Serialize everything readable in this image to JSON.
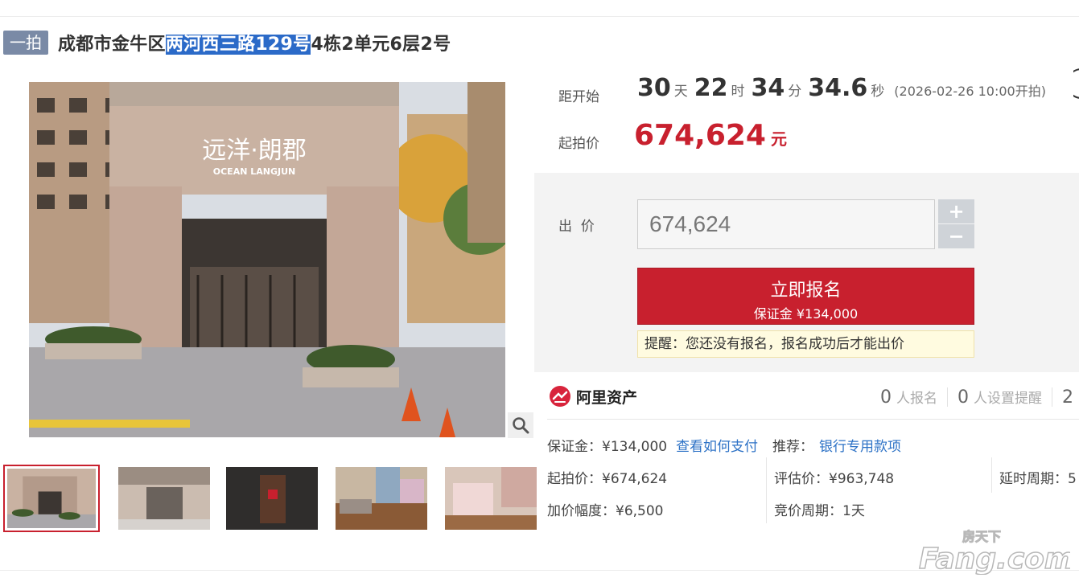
{
  "header": {
    "badge": "一拍",
    "title_prefix": "成都市金牛区",
    "title_highlight": "两河西三路129号",
    "title_suffix": "4栋2单元6层2号"
  },
  "gallery": {
    "main_image_sign_cn": "远洋·朗郡",
    "main_image_sign_en": "OCEAN LANGJUN",
    "thumbnails": [
      "building-entrance",
      "lobby",
      "apartment-door",
      "living-room",
      "bedroom"
    ]
  },
  "countdown": {
    "label": "距开始",
    "days": "30",
    "days_unit": "天",
    "hours": "22",
    "hours_unit": "时",
    "minutes": "34",
    "minutes_unit": "分",
    "seconds": "34.6",
    "seconds_unit": "秒",
    "start_time": "(2026-02-26 10:00开拍)"
  },
  "starting_price": {
    "label": "起拍价",
    "value": "674,624",
    "unit": "元"
  },
  "bid": {
    "label": "出  价",
    "input_value": "674,624",
    "plus": "+",
    "minus": "−",
    "apply_button": "立即报名",
    "deposit_line": "保证金 ¥134,000",
    "notice": "提醒：您还没有报名，报名成功后才能出价"
  },
  "platform": {
    "name": "阿里资产",
    "registrations_count": "0",
    "registrations_label": "人报名",
    "reminders_count": "0",
    "reminders_label": "人设置提醒",
    "views_count_partial": "2"
  },
  "details": {
    "deposit": "保证金：¥134,000",
    "how_to_pay": "查看如何支付",
    "recommend_label": "推荐：",
    "recommend_link": "银行专用款项",
    "starting_price": "起拍价：¥674,624",
    "appraisal": "评估价：¥963,748",
    "delay_period": "延时周期：5",
    "increment": "加价幅度：¥6,500",
    "bid_period": "竞价周期：1天"
  },
  "watermark": {
    "top": "房天下",
    "bottom": "Fang.com"
  },
  "colors": {
    "accent_red": "#c8202e",
    "link_blue": "#2d72c6",
    "badge_gray": "#7a8aa6"
  }
}
